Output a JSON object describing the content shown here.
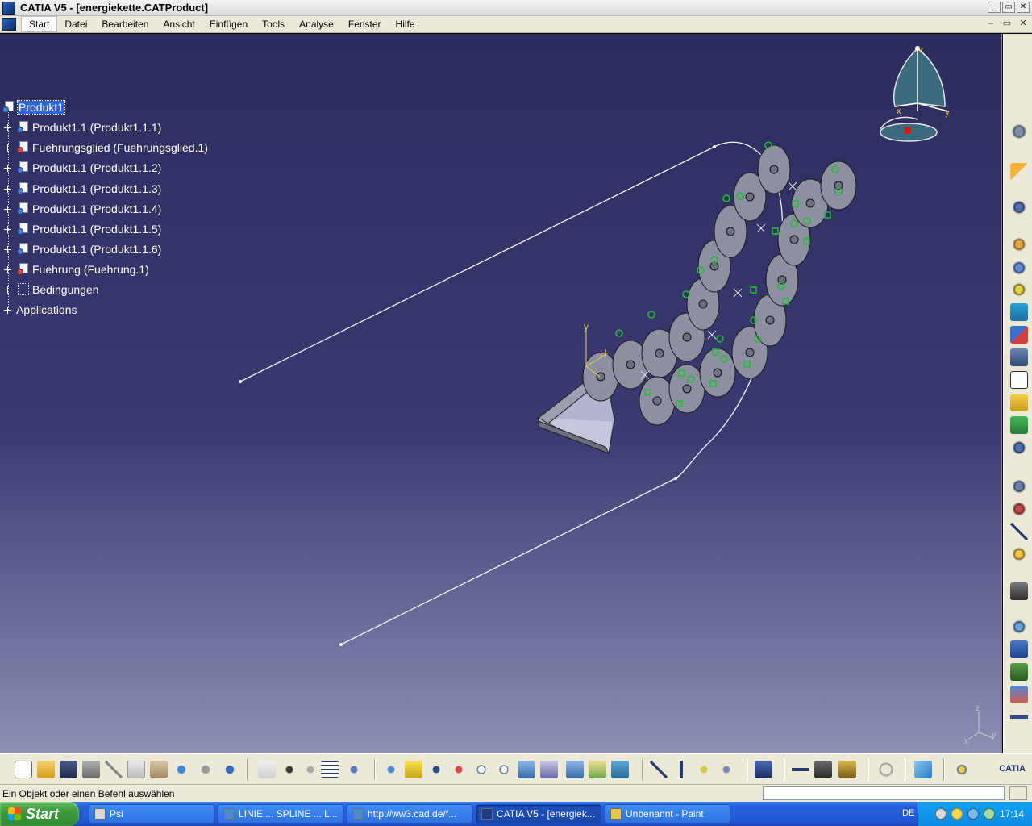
{
  "window": {
    "title": "CATIA V5 - [energiekette.CATProduct]",
    "controls": [
      "_",
      "▭",
      "✕"
    ]
  },
  "menu": {
    "items": [
      "Start",
      "Datei",
      "Bearbeiten",
      "Ansicht",
      "Einfügen",
      "Tools",
      "Analyse",
      "Fenster",
      "Hilfe"
    ],
    "active": "Start",
    "mdi_controls": [
      "–",
      "▭",
      "✕"
    ]
  },
  "tree": {
    "root": "Produkt1",
    "children": [
      {
        "label": "Produkt1.1 (Produkt1.1.1)",
        "icon": "product-icon"
      },
      {
        "label": "Fuehrungsglied (Fuehrungsglied.1)",
        "icon": "product-red-icon"
      },
      {
        "label": "Produkt1.1 (Produkt1.1.2)",
        "icon": "product-icon"
      },
      {
        "label": "Produkt1.1 (Produkt1.1.3)",
        "icon": "product-icon"
      },
      {
        "label": "Produkt1.1 (Produkt1.1.4)",
        "icon": "product-icon"
      },
      {
        "label": "Produkt1.1 (Produkt1.1.5)",
        "icon": "product-icon"
      },
      {
        "label": "Produkt1.1 (Produkt1.1.6)",
        "icon": "product-icon"
      },
      {
        "label": "Fuehrung (Fuehrung.1)",
        "icon": "product-red-icon"
      },
      {
        "label": "Bedingungen",
        "icon": "constraints-icon"
      },
      {
        "label": "Applications",
        "icon": ""
      }
    ]
  },
  "compass": {
    "x": "x",
    "y": "y",
    "z": "z"
  },
  "axis_triad": {
    "x": "x",
    "y": "y",
    "z": "z"
  },
  "part_axes": {
    "y": "y",
    "h": "H"
  },
  "colors": {
    "viewport_top": "#2c2c5e",
    "viewport_bottom": "#8e8fb4",
    "part_fill": "#8d8fa2",
    "constraint_green": "#1fbf2d",
    "selection": "#3066d8"
  },
  "status": {
    "message": "Ein Objekt oder einen Befehl auswählen",
    "command_placeholder": ""
  },
  "bottom_toolbar": {
    "brand": "CATIA"
  },
  "taskbar": {
    "start_label": "Start",
    "tasks": [
      {
        "label": "Psi"
      },
      {
        "label": "LINIE ... SPLINE ... L..."
      },
      {
        "label": "http://ww3.cad.de/f..."
      },
      {
        "label": "CATIA V5 - [energiek..."
      },
      {
        "label": "Unbenannt - Paint"
      }
    ],
    "active_task": 3,
    "language": "DE",
    "clock": "17:14"
  }
}
